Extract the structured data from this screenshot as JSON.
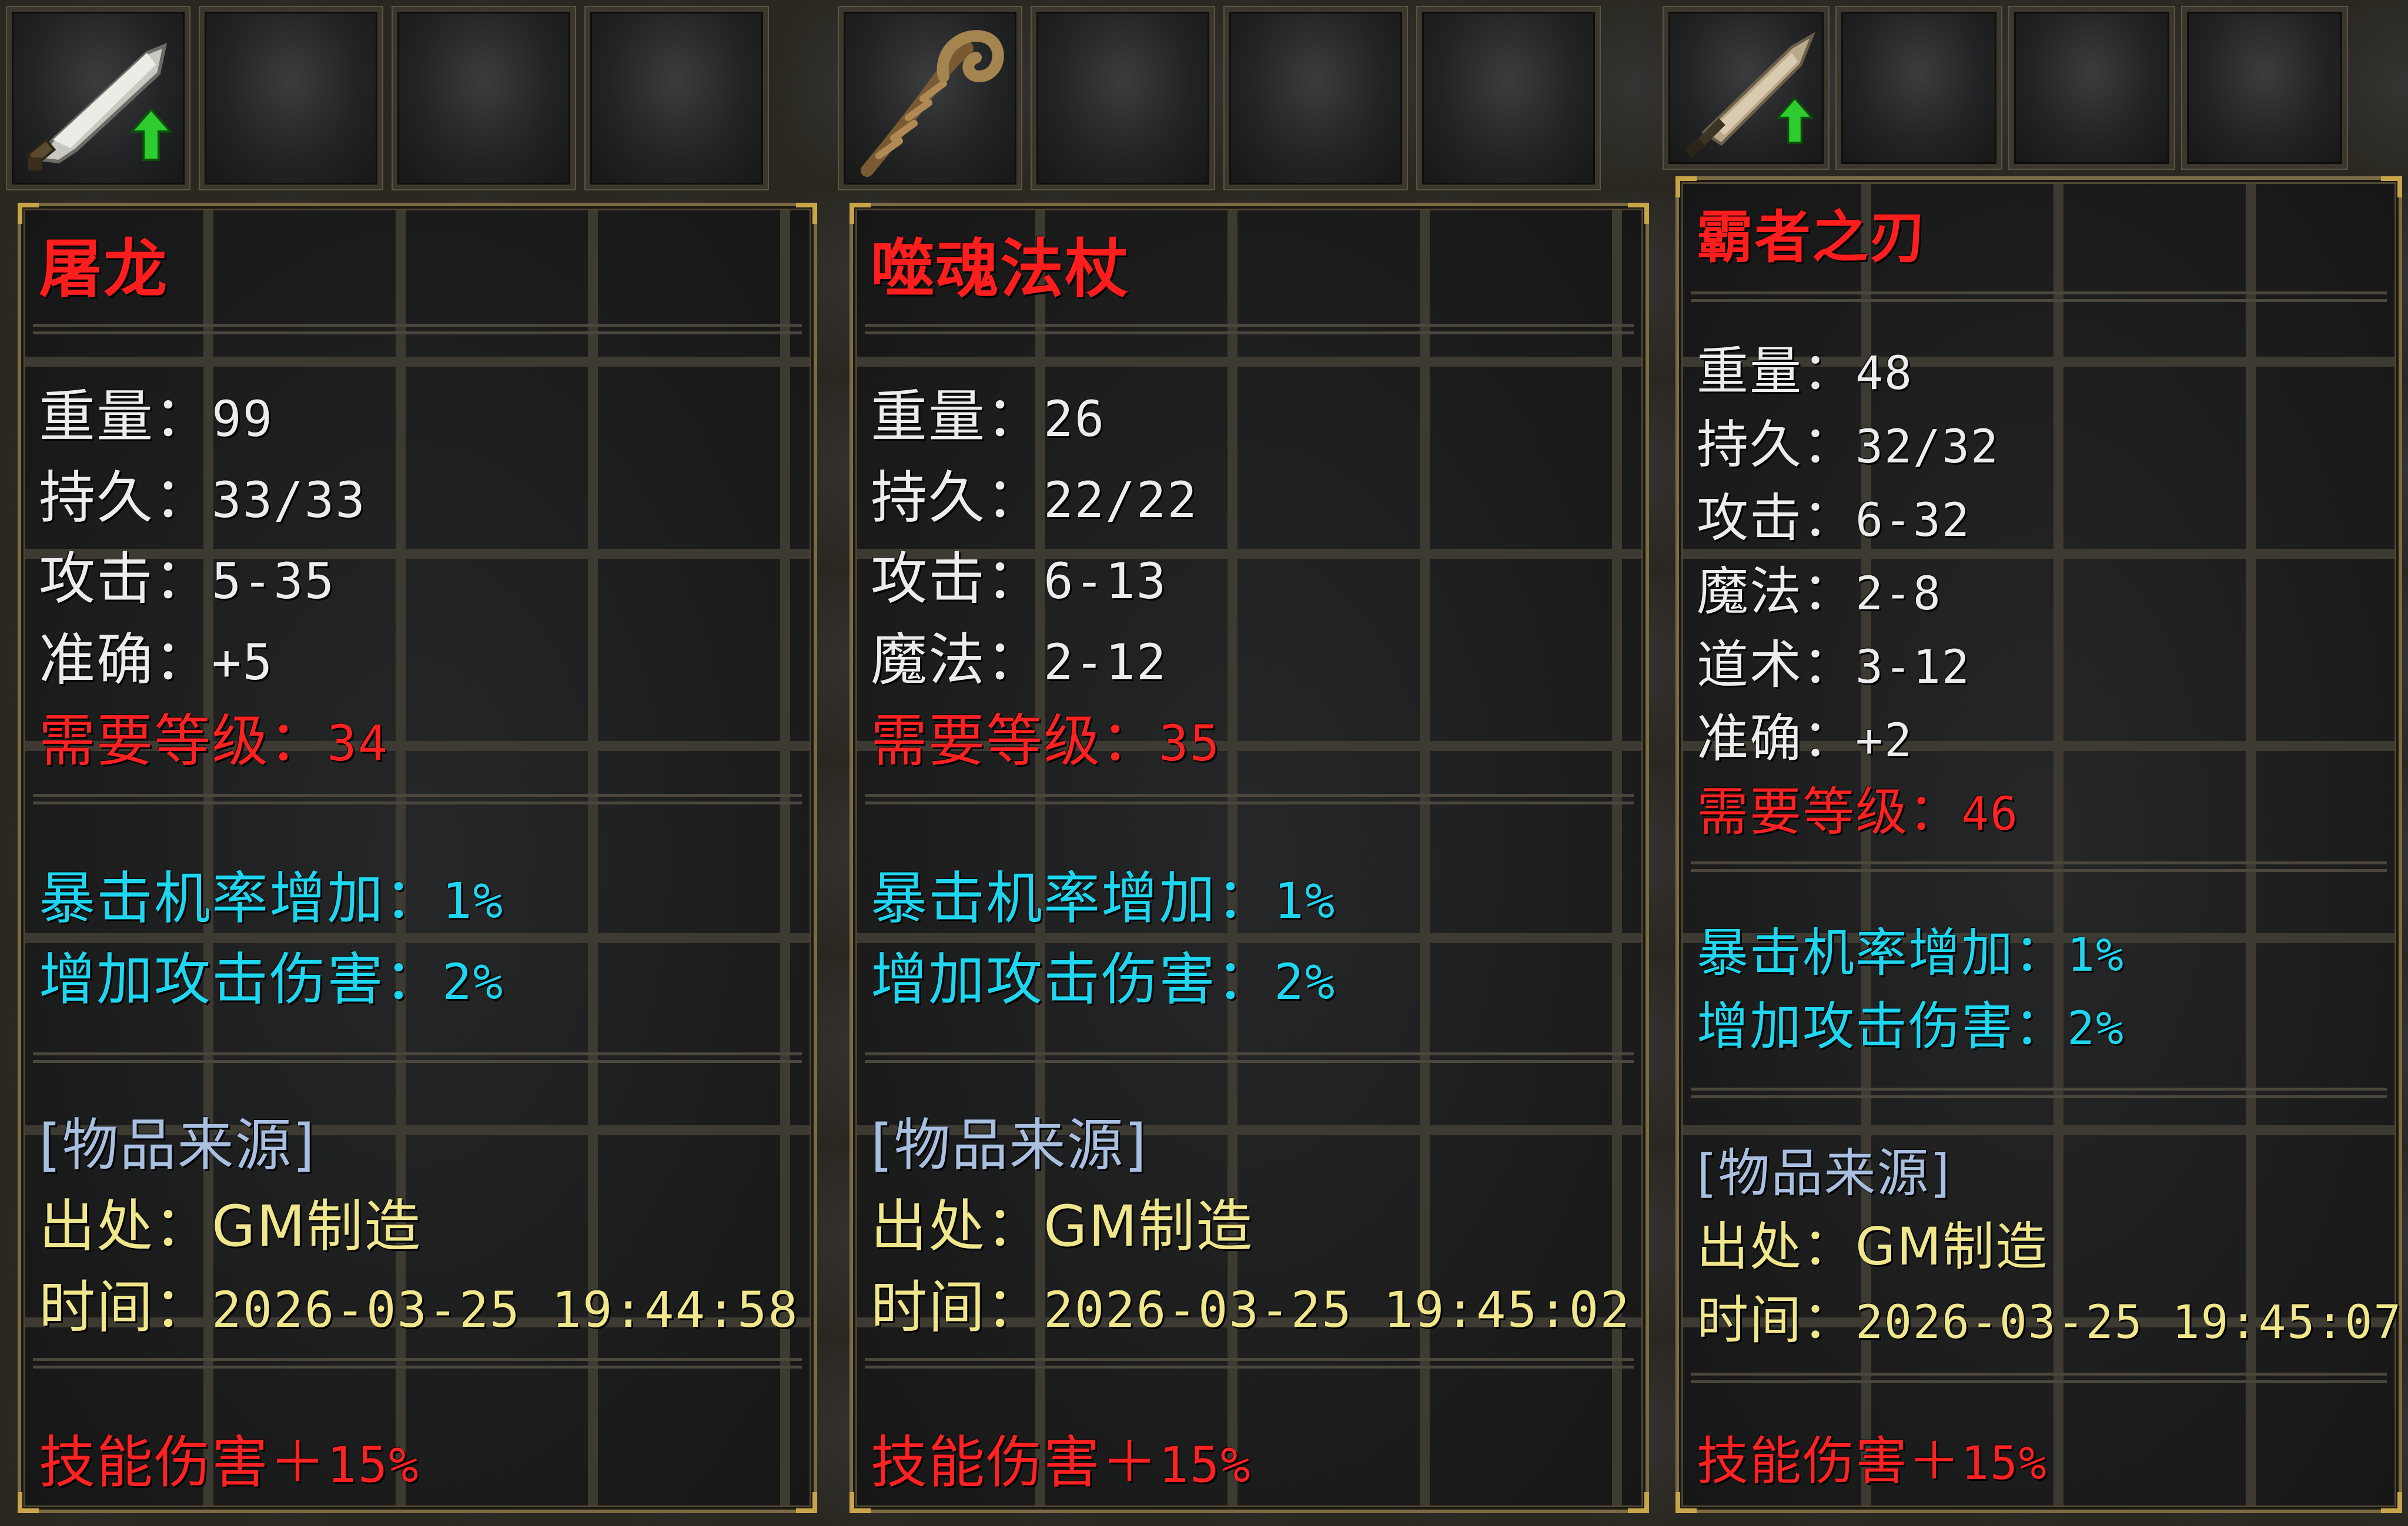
{
  "items": [
    {
      "name": "屠龙",
      "icon": "broad-sword-icon",
      "show_upgrade": true,
      "stats": [
        {
          "label": "重量：",
          "value": "99"
        },
        {
          "label": "持久：",
          "value": "33/33"
        },
        {
          "label": "攻击：",
          "value": "5-35"
        },
        {
          "label": "准确：",
          "value": "+5"
        }
      ],
      "requirement": {
        "label": "需要等级：",
        "value": "34"
      },
      "bonuses": [
        {
          "label": "暴击机率增加：",
          "value": "1%"
        },
        {
          "label": "增加攻击伤害：",
          "value": "2%"
        }
      ],
      "source_header": "[物品来源]",
      "origin": {
        "label": "出处：",
        "value": "GM制造"
      },
      "time": {
        "label": "时间：",
        "value": "2026-03-25 19:44:58"
      },
      "skill": {
        "label": "技能伤害＋",
        "value": "15%"
      }
    },
    {
      "name": "噬魂法杖",
      "icon": "staff-icon",
      "show_upgrade": false,
      "stats": [
        {
          "label": "重量：",
          "value": "26"
        },
        {
          "label": "持久：",
          "value": "22/22"
        },
        {
          "label": "攻击：",
          "value": "6-13"
        },
        {
          "label": "魔法：",
          "value": "2-12"
        }
      ],
      "requirement": {
        "label": "需要等级：",
        "value": "35"
      },
      "bonuses": [
        {
          "label": "暴击机率增加：",
          "value": "1%"
        },
        {
          "label": "增加攻击伤害：",
          "value": "2%"
        }
      ],
      "source_header": "[物品来源]",
      "origin": {
        "label": "出处：",
        "value": "GM制造"
      },
      "time": {
        "label": "时间：",
        "value": "2026-03-25 19:45:02"
      },
      "skill": {
        "label": "技能伤害＋",
        "value": "15%"
      }
    },
    {
      "name": "霸者之刃",
      "icon": "blade-icon",
      "show_upgrade": true,
      "stats": [
        {
          "label": "重量：",
          "value": "48"
        },
        {
          "label": "持久：",
          "value": "32/32"
        },
        {
          "label": "攻击：",
          "value": "6-32"
        },
        {
          "label": "魔法：",
          "value": "2-8"
        },
        {
          "label": "道术：",
          "value": "3-12"
        },
        {
          "label": "准确：",
          "value": "+2"
        }
      ],
      "requirement": {
        "label": "需要等级：",
        "value": "46"
      },
      "bonuses": [
        {
          "label": "暴击机率增加：",
          "value": "1%"
        },
        {
          "label": "增加攻击伤害：",
          "value": "2%"
        }
      ],
      "source_header": "[物品来源]",
      "origin": {
        "label": "出处：",
        "value": "GM制造"
      },
      "time": {
        "label": "时间：",
        "value": "2026-03-25 19:45:07"
      },
      "skill": {
        "label": "技能伤害＋",
        "value": "15%"
      }
    }
  ],
  "colors": {
    "title": "#ff1e1e",
    "stat": "#ececec",
    "requirement": "#ff2222",
    "bonus": "#1fd6f0",
    "source_header": "#a9bfe0",
    "source": "#f0e68c",
    "frame_gold": "#c9a54a",
    "upgrade_arrow": "#2ecc2e"
  }
}
